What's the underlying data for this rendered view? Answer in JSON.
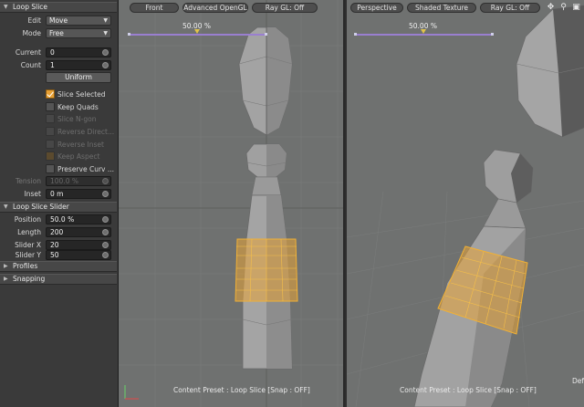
{
  "panel": {
    "loop_slice_header": "Loop Slice",
    "edit_label": "Edit",
    "edit_value": "Move",
    "mode_label": "Mode",
    "mode_value": "Free",
    "current_label": "Current",
    "current_value": "0",
    "count_label": "Count",
    "count_value": "1",
    "uniform_button": "Uniform",
    "checks": [
      {
        "label": "Slice Selected",
        "checked": true,
        "enabled": true
      },
      {
        "label": "Keep Quads",
        "checked": false,
        "enabled": true
      },
      {
        "label": "Slice N-gon",
        "checked": false,
        "enabled": false
      },
      {
        "label": "Reverse Direct...",
        "checked": false,
        "enabled": false
      },
      {
        "label": "Reverse Inset",
        "checked": false,
        "enabled": false
      },
      {
        "label": "Keep Aspect",
        "checked": true,
        "enabled": false
      },
      {
        "label": "Preserve Curv ...",
        "checked": false,
        "enabled": true
      }
    ],
    "tension_label": "Tension",
    "tension_value": "100.0 %",
    "inset_label": "Inset",
    "inset_value": "0 m",
    "slider_header": "Loop Slice Slider",
    "position_label": "Position",
    "position_value": "50.0 %",
    "length_label": "Length",
    "length_value": "200",
    "sliderx_label": "Slider X",
    "sliderx_value": "20",
    "slidery_label": "Slider Y",
    "slidery_value": "50",
    "profiles_header": "Profiles",
    "snapping_header": "Snapping"
  },
  "viewport_left": {
    "view_button": "Front",
    "shading_button": "Advanced OpenGL",
    "raygl_button": "Ray GL: Off",
    "slider_percent": "50.00 %",
    "status": "Content Preset : Loop Slice  [Snap : OFF]"
  },
  "viewport_right": {
    "view_button": "Perspective",
    "shading_button": "Shaded Texture",
    "raygl_button": "Ray GL: Off",
    "slider_percent": "50.00 %",
    "status": "Content Preset : Loop Slice  [Snap : OFF]",
    "corner_text": "Def"
  },
  "colors": {
    "accent_orange": "#e7a034",
    "selection_yellow": "#f2b134",
    "slider_purple": "#9a7fd0",
    "mesh_gray": "#9a9a9a"
  },
  "icons": [
    "move-view-icon",
    "zoom-icon",
    "maximize-icon",
    "axis-gizmo-icon"
  ]
}
